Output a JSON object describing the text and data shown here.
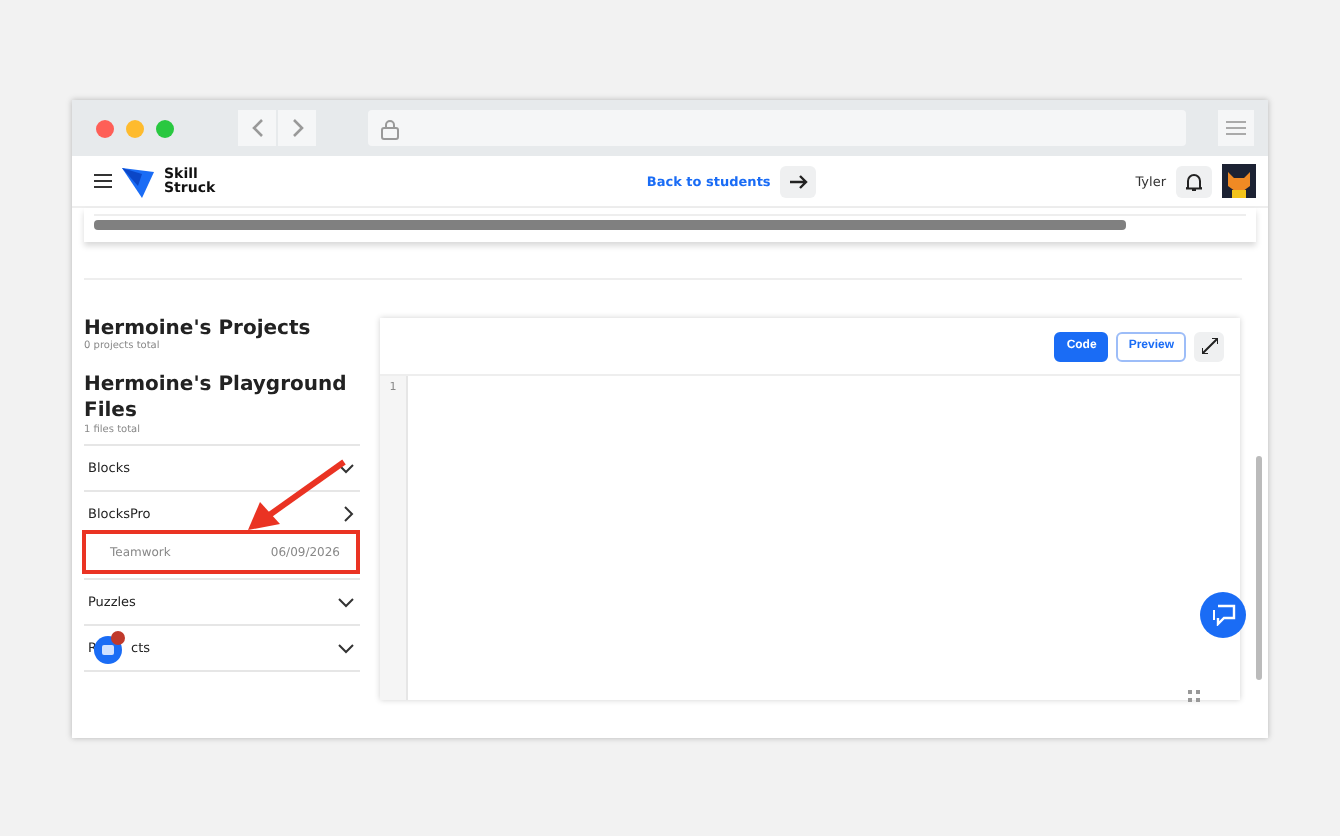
{
  "nav": {
    "brand": "Skill Struck",
    "back_link": "Back to students",
    "user": "Tyler"
  },
  "projects": {
    "title": "Hermoine's Projects",
    "count": "0 projects total"
  },
  "playground": {
    "title": "Hermoine's Playground Files",
    "count": "1 files total",
    "sections": [
      {
        "label": "Blocks",
        "expanded": false
      },
      {
        "label": "BlocksPro",
        "expanded": true,
        "files": [
          {
            "name": "Teamwork",
            "date": "06/09/2026",
            "highlighted": true
          }
        ]
      },
      {
        "label": "Puzzles",
        "expanded": false
      },
      {
        "label": "R",
        "label_after_badge": "cts",
        "expanded": false
      }
    ]
  },
  "editor": {
    "tabs": [
      {
        "label": "Code",
        "selected": true
      },
      {
        "label": "Preview",
        "selected": false
      }
    ],
    "line_numbers": [
      "1"
    ]
  }
}
